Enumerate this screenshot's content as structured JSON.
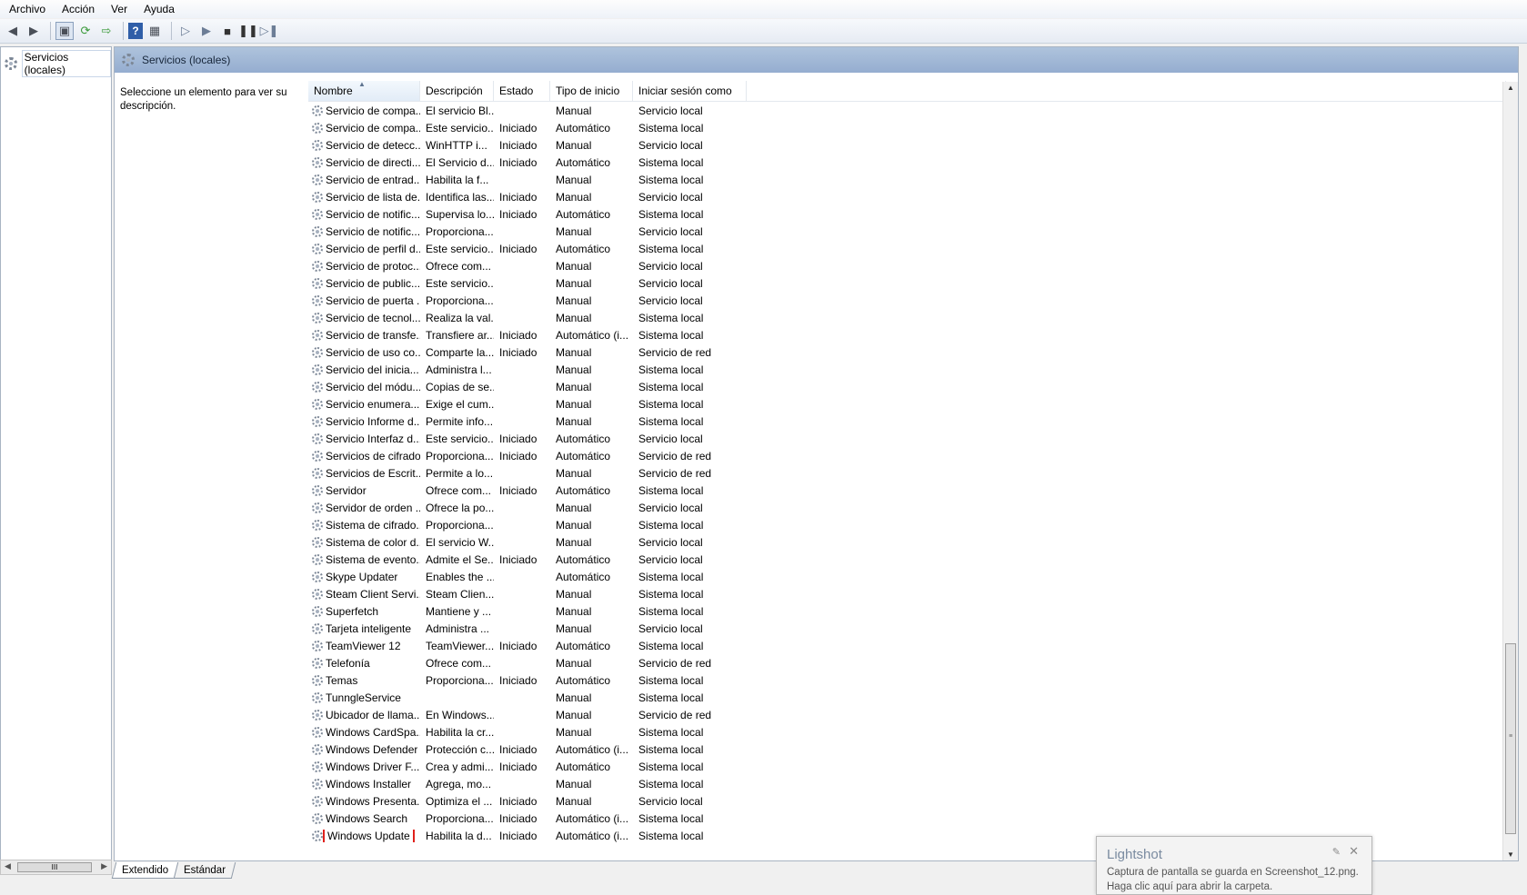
{
  "menu": [
    "Archivo",
    "Acción",
    "Ver",
    "Ayuda"
  ],
  "toolbar": {
    "icons": [
      "back-arrow-icon",
      "forward-arrow-icon",
      "console-tree-icon",
      "refresh-icon",
      "export-icon",
      "help-icon",
      "properties-icon",
      "play-icon",
      "play-alt-icon",
      "stop-icon",
      "pause-icon",
      "resume-icon"
    ]
  },
  "tree": {
    "root_label": "Servicios (locales)"
  },
  "content": {
    "header_title": "Servicios (locales)",
    "description": "Seleccione un elemento para ver su descripción."
  },
  "columns": [
    "Nombre",
    "Descripción",
    "Estado",
    "Tipo de inicio",
    "Iniciar sesión como"
  ],
  "rows": [
    [
      "Servicio de compa...",
      "El servicio Bl...",
      "",
      "Manual",
      "Servicio local"
    ],
    [
      "Servicio de compa...",
      "Este servicio...",
      "Iniciado",
      "Automático",
      "Sistema local"
    ],
    [
      "Servicio de detecc...",
      "WinHTTP i...",
      "Iniciado",
      "Manual",
      "Servicio local"
    ],
    [
      "Servicio de directi...",
      "El Servicio d...",
      "Iniciado",
      "Automático",
      "Sistema local"
    ],
    [
      "Servicio de entrad...",
      "Habilita la f...",
      "",
      "Manual",
      "Sistema local"
    ],
    [
      "Servicio de lista de...",
      "Identifica las...",
      "Iniciado",
      "Manual",
      "Servicio local"
    ],
    [
      "Servicio de notific...",
      "Supervisa lo...",
      "Iniciado",
      "Automático",
      "Sistema local"
    ],
    [
      "Servicio de notific...",
      "Proporciona...",
      "",
      "Manual",
      "Servicio local"
    ],
    [
      "Servicio de perfil d...",
      "Este servicio...",
      "Iniciado",
      "Automático",
      "Sistema local"
    ],
    [
      "Servicio de protoc...",
      "Ofrece com...",
      "",
      "Manual",
      "Servicio local"
    ],
    [
      "Servicio de public...",
      "Este servicio...",
      "",
      "Manual",
      "Servicio local"
    ],
    [
      "Servicio de puerta ...",
      "Proporciona...",
      "",
      "Manual",
      "Servicio local"
    ],
    [
      "Servicio de tecnol...",
      "Realiza la val...",
      "",
      "Manual",
      "Sistema local"
    ],
    [
      "Servicio de transfe...",
      "Transfiere ar...",
      "Iniciado",
      "Automático (i...",
      "Sistema local"
    ],
    [
      "Servicio de uso co...",
      "Comparte la...",
      "Iniciado",
      "Manual",
      "Servicio de red"
    ],
    [
      "Servicio del inicia...",
      "Administra l...",
      "",
      "Manual",
      "Sistema local"
    ],
    [
      "Servicio del módu...",
      "Copias de se...",
      "",
      "Manual",
      "Sistema local"
    ],
    [
      "Servicio enumera...",
      "Exige el cum...",
      "",
      "Manual",
      "Sistema local"
    ],
    [
      "Servicio Informe d...",
      "Permite info...",
      "",
      "Manual",
      "Sistema local"
    ],
    [
      "Servicio Interfaz d...",
      "Este servicio...",
      "Iniciado",
      "Automático",
      "Servicio local"
    ],
    [
      "Servicios de cifrado",
      "Proporciona...",
      "Iniciado",
      "Automático",
      "Servicio de red"
    ],
    [
      "Servicios de Escrit...",
      "Permite a lo...",
      "",
      "Manual",
      "Servicio de red"
    ],
    [
      "Servidor",
      "Ofrece com...",
      "Iniciado",
      "Automático",
      "Sistema local"
    ],
    [
      "Servidor de orden ...",
      "Ofrece la po...",
      "",
      "Manual",
      "Servicio local"
    ],
    [
      "Sistema de cifrado...",
      "Proporciona...",
      "",
      "Manual",
      "Sistema local"
    ],
    [
      "Sistema de color d...",
      "El servicio W...",
      "",
      "Manual",
      "Servicio local"
    ],
    [
      "Sistema de evento...",
      "Admite el Se...",
      "Iniciado",
      "Automático",
      "Servicio local"
    ],
    [
      "Skype Updater",
      "Enables the ...",
      "",
      "Automático",
      "Sistema local"
    ],
    [
      "Steam Client Servi...",
      "Steam Clien...",
      "",
      "Manual",
      "Sistema local"
    ],
    [
      "Superfetch",
      "Mantiene y ...",
      "",
      "Manual",
      "Sistema local"
    ],
    [
      "Tarjeta inteligente",
      "Administra ...",
      "",
      "Manual",
      "Servicio local"
    ],
    [
      "TeamViewer 12",
      "TeamViewer...",
      "Iniciado",
      "Automático",
      "Sistema local"
    ],
    [
      "Telefonía",
      "Ofrece com...",
      "",
      "Manual",
      "Servicio de red"
    ],
    [
      "Temas",
      "Proporciona...",
      "Iniciado",
      "Automático",
      "Sistema local"
    ],
    [
      "TunngleService",
      "",
      "",
      "Manual",
      "Sistema local"
    ],
    [
      "Ubicador de llama...",
      "En Windows...",
      "",
      "Manual",
      "Servicio de red"
    ],
    [
      "Windows CardSpa...",
      "Habilita la cr...",
      "",
      "Manual",
      "Sistema local"
    ],
    [
      "Windows Defender",
      "Protección c...",
      "Iniciado",
      "Automático (i...",
      "Sistema local"
    ],
    [
      "Windows Driver F...",
      "Crea y admi...",
      "Iniciado",
      "Automático",
      "Sistema local"
    ],
    [
      "Windows Installer",
      "Agrega, mo...",
      "",
      "Manual",
      "Sistema local"
    ],
    [
      "Windows Presenta...",
      "Optimiza el ...",
      "Iniciado",
      "Manual",
      "Servicio local"
    ],
    [
      "Windows Search",
      "Proporciona...",
      "Iniciado",
      "Automático (i...",
      "Sistema local"
    ],
    [
      "Windows Update",
      "Habilita la d...",
      "Iniciado",
      "Automático (i...",
      "Sistema local"
    ]
  ],
  "highlighted_row": "Windows Update",
  "tabs": [
    "Extendido",
    "Estándar"
  ],
  "notification": {
    "title": "Lightshot",
    "line1": "Captura de pantalla se guarda en Screenshot_12.png.",
    "line2": "Haga clic aquí para abrir la carpeta."
  },
  "colors": {
    "highlight_outline": "#e0201b",
    "header_blue": "#95add0"
  }
}
